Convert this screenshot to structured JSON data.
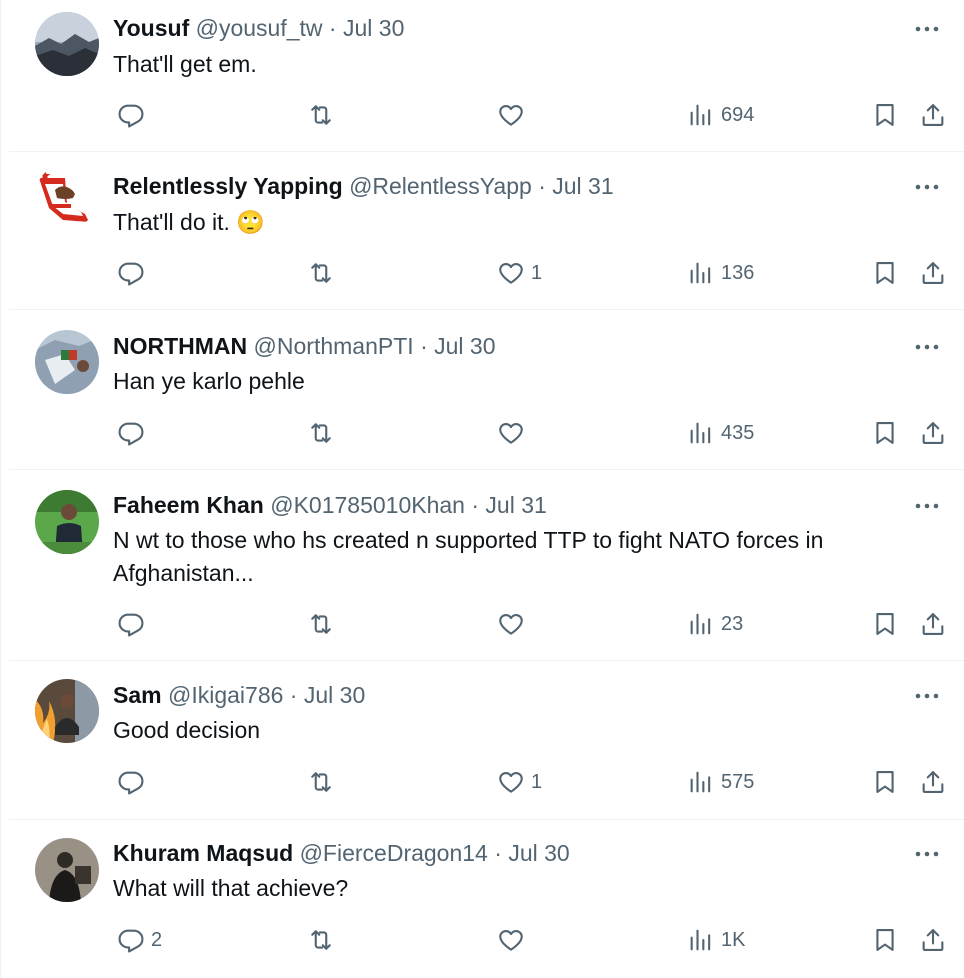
{
  "tweets": [
    {
      "name": "Yousuf",
      "handle": "@yousuf_tw",
      "dot": "·",
      "date": "Jul 30",
      "text": "That'll get em.",
      "emoji": "",
      "replies": "",
      "likes": "",
      "views": "694"
    },
    {
      "name": "Relentlessly Yapping",
      "handle": "@RelentlessYapp",
      "dot": "·",
      "date": "Jul 31",
      "text": "That'll do it.",
      "emoji": "🙄",
      "replies": "",
      "likes": "1",
      "views": "136"
    },
    {
      "name": "NORTHMAN",
      "handle": "@NorthmanPTI",
      "dot": "·",
      "date": "Jul 30",
      "text": "Han ye karlo pehle",
      "emoji": "",
      "replies": "",
      "likes": "",
      "views": "435"
    },
    {
      "name": "Faheem Khan",
      "handle": "@K01785010Khan",
      "dot": "·",
      "date": "Jul 31",
      "text": "N wt to those who hs created n supported TTP to fight NATO forces in Afghanistan...",
      "emoji": "",
      "replies": "",
      "likes": "",
      "views": "23"
    },
    {
      "name": "Sam",
      "handle": "@Ikigai786",
      "dot": "·",
      "date": "Jul 30",
      "text": "Good decision",
      "emoji": "",
      "replies": "",
      "likes": "1",
      "views": "575"
    },
    {
      "name": "Khuram Maqsud",
      "handle": "@FierceDragon14",
      "dot": "·",
      "date": "Jul 30",
      "text": "What will that achieve?",
      "emoji": "",
      "replies": "2",
      "likes": "",
      "views": "1K"
    }
  ],
  "icons": {
    "reply": "reply-icon",
    "retweet": "retweet-icon",
    "like": "heart-icon",
    "views": "views-icon",
    "bookmark": "bookmark-icon",
    "share": "share-icon",
    "more": "more-icon"
  },
  "colors": {
    "text": "#0f1419",
    "secondary": "#536471",
    "divider": "#eff3f4"
  }
}
